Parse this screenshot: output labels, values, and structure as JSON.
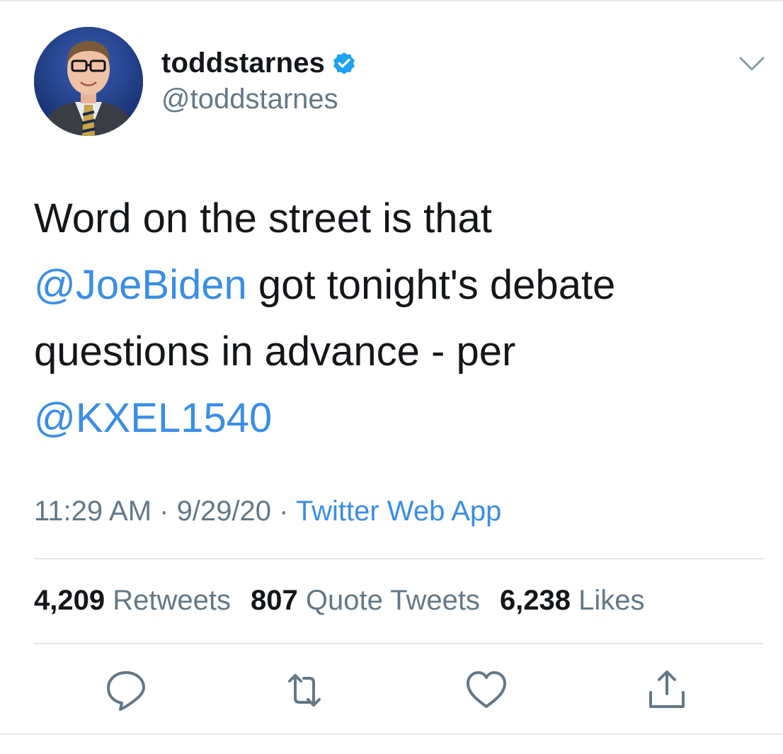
{
  "tweet": {
    "author": {
      "display_name": "toddstarnes",
      "handle": "@toddstarnes",
      "verified": true,
      "avatar_icon": "profile-photo"
    },
    "text_lines": [
      [
        {
          "text": "Word on the street is that",
          "type": "text"
        }
      ],
      [
        {
          "text": "@JoeBiden",
          "type": "mention"
        },
        {
          "text": " got tonight's debate",
          "type": "text"
        }
      ],
      [
        {
          "text": "questions in advance - per",
          "type": "text"
        }
      ],
      [
        {
          "text": "@KXEL1540",
          "type": "mention"
        }
      ]
    ],
    "meta": {
      "time": "11:29 AM",
      "separator": " · ",
      "date": "9/29/20",
      "source": "Twitter Web App"
    },
    "stats": {
      "retweets_count": "4,209",
      "retweets_label": "Retweets",
      "quotes_count": "807",
      "quotes_label": "Quote Tweets",
      "likes_count": "6,238",
      "likes_label": "Likes"
    },
    "actions": [
      "reply-icon",
      "retweet-icon",
      "like-icon",
      "share-icon"
    ]
  },
  "colors": {
    "link": "#3a8ee6",
    "text": "#14171a",
    "secondary": "#657786",
    "divider": "#e1e8ed",
    "verified_badge": "#1da1f2"
  }
}
